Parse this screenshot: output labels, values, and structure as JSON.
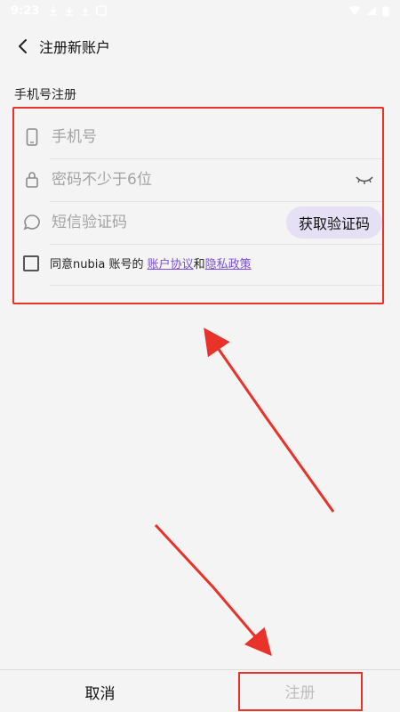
{
  "status_bar": {
    "time": "9:23",
    "icons": [
      "download-icon",
      "download-icon",
      "download-icon",
      "notification-icon",
      "wifi-icon",
      "signal-icon",
      "battery-icon"
    ]
  },
  "header": {
    "back_icon": "chevron-left-icon",
    "title": "注册新账户"
  },
  "section": {
    "title": "手机号注册"
  },
  "form": {
    "phone": {
      "placeholder": "手机号",
      "value": "",
      "icon": "phone-icon"
    },
    "password": {
      "placeholder": "密码不少于6位",
      "value": "",
      "icon": "lock-icon",
      "toggle_icon": "eye-closed-icon"
    },
    "sms": {
      "placeholder": "短信验证码",
      "value": "",
      "icon": "message-icon",
      "button_label": "获取验证码"
    },
    "agreement": {
      "prefix": "同意nubia 账号的 ",
      "terms_link": "账户协议",
      "middle": "和",
      "privacy_link": "隐私政策"
    }
  },
  "bottom_bar": {
    "cancel_label": "取消",
    "register_label": "注册"
  },
  "colors": {
    "annotation_red": "#e8322a",
    "accent_purple": "#7b4fd2",
    "code_button_bg": "#e6e0f4"
  }
}
